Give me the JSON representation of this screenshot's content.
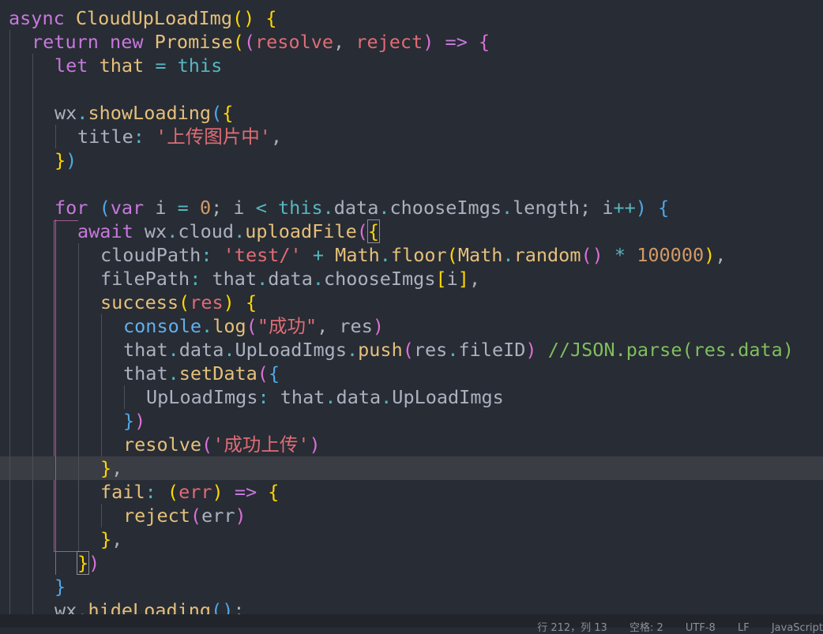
{
  "editor": {
    "lines": [
      [
        [
          "t-kw",
          "async "
        ],
        [
          "t-fn2",
          "CloudUpLoadImg"
        ],
        [
          "t-b1",
          "()"
        ],
        [
          "t-var",
          " "
        ],
        [
          "t-b1",
          "{"
        ]
      ],
      [
        [
          "t-kw",
          "return "
        ],
        [
          "t-kw",
          "new "
        ],
        [
          "t-cls",
          "Promise"
        ],
        [
          "t-b1",
          "("
        ],
        [
          "t-b2",
          "("
        ],
        [
          "t-param",
          "resolve"
        ],
        [
          "t-var",
          ", "
        ],
        [
          "t-param",
          "reject"
        ],
        [
          "t-b2",
          ")"
        ],
        [
          "t-var",
          " "
        ],
        [
          "t-kw",
          "=>"
        ],
        [
          "t-var",
          " "
        ],
        [
          "t-b2",
          "{"
        ]
      ],
      [
        [
          "t-kw",
          "let "
        ],
        [
          "t-cls",
          "that"
        ],
        [
          "t-var",
          " "
        ],
        [
          "t-op",
          "="
        ],
        [
          "t-var",
          " "
        ],
        [
          "t-this",
          "this"
        ]
      ],
      [],
      [
        [
          "t-var",
          "wx"
        ],
        [
          "t-op",
          "."
        ],
        [
          "t-fn2",
          "showLoading"
        ],
        [
          "t-b3",
          "("
        ],
        [
          "t-b1",
          "{"
        ]
      ],
      [
        [
          "t-var",
          "title"
        ],
        [
          "t-op",
          ":"
        ],
        [
          "t-var",
          " "
        ],
        [
          "t-strzh",
          "'上传图片中'"
        ],
        [
          "t-var",
          ","
        ]
      ],
      [
        [
          "t-b1",
          "}"
        ],
        [
          "t-b3",
          ")"
        ]
      ],
      [],
      [
        [
          "t-kw",
          "for "
        ],
        [
          "t-b3",
          "("
        ],
        [
          "t-kw",
          "var "
        ],
        [
          "t-var",
          "i "
        ],
        [
          "t-op",
          "="
        ],
        [
          "t-var",
          " "
        ],
        [
          "t-num",
          "0"
        ],
        [
          "t-var",
          "; i "
        ],
        [
          "t-op",
          "<"
        ],
        [
          "t-var",
          " "
        ],
        [
          "t-this",
          "this"
        ],
        [
          "t-op",
          "."
        ],
        [
          "t-var",
          "data"
        ],
        [
          "t-op",
          "."
        ],
        [
          "t-var",
          "chooseImgs"
        ],
        [
          "t-op",
          "."
        ],
        [
          "t-var",
          "length; i"
        ],
        [
          "t-op",
          "++"
        ],
        [
          "t-b3",
          ")"
        ],
        [
          "t-var",
          " "
        ],
        [
          "t-b3",
          "{"
        ]
      ],
      [
        [
          "t-kw",
          "await "
        ],
        [
          "t-var",
          "wx"
        ],
        [
          "t-op",
          "."
        ],
        [
          "t-var",
          "cloud"
        ],
        [
          "t-op",
          "."
        ],
        [
          "t-fn2",
          "uploadFile"
        ],
        [
          "t-b2",
          "("
        ],
        [
          "box",
          "{"
        ]
      ],
      [
        [
          "t-var",
          "cloudPath"
        ],
        [
          "t-op",
          ":"
        ],
        [
          "t-var",
          " "
        ],
        [
          "t-strzh",
          "'test/'"
        ],
        [
          "t-var",
          " "
        ],
        [
          "t-op",
          "+"
        ],
        [
          "t-var",
          " "
        ],
        [
          "t-cls",
          "Math"
        ],
        [
          "t-op",
          "."
        ],
        [
          "t-fn2",
          "floor"
        ],
        [
          "t-b1",
          "("
        ],
        [
          "t-cls",
          "Math"
        ],
        [
          "t-op",
          "."
        ],
        [
          "t-fn2",
          "random"
        ],
        [
          "t-b2",
          "()"
        ],
        [
          "t-var",
          " "
        ],
        [
          "t-op",
          "*"
        ],
        [
          "t-var",
          " "
        ],
        [
          "t-num",
          "100000"
        ],
        [
          "t-b1",
          ")"
        ],
        [
          "t-var",
          ","
        ]
      ],
      [
        [
          "t-var",
          "filePath"
        ],
        [
          "t-op",
          ":"
        ],
        [
          "t-var",
          " that"
        ],
        [
          "t-op",
          "."
        ],
        [
          "t-var",
          "data"
        ],
        [
          "t-op",
          "."
        ],
        [
          "t-var",
          "chooseImgs"
        ],
        [
          "t-b1",
          "["
        ],
        [
          "t-var",
          "i"
        ],
        [
          "t-b1",
          "]"
        ],
        [
          "t-var",
          ","
        ]
      ],
      [
        [
          "t-fn2",
          "success"
        ],
        [
          "t-b1",
          "("
        ],
        [
          "t-param",
          "res"
        ],
        [
          "t-b1",
          ")"
        ],
        [
          "t-var",
          " "
        ],
        [
          "t-b1",
          "{"
        ]
      ],
      [
        [
          "t-fn",
          "console"
        ],
        [
          "t-op",
          "."
        ],
        [
          "t-fn2",
          "log"
        ],
        [
          "t-b2",
          "("
        ],
        [
          "t-strzh",
          "\"成功\""
        ],
        [
          "t-var",
          ", res"
        ],
        [
          "t-b2",
          ")"
        ]
      ],
      [
        [
          "t-var",
          "that"
        ],
        [
          "t-op",
          "."
        ],
        [
          "t-var",
          "data"
        ],
        [
          "t-op",
          "."
        ],
        [
          "t-var",
          "UpLoadImgs"
        ],
        [
          "t-op",
          "."
        ],
        [
          "t-fn2",
          "push"
        ],
        [
          "t-b2",
          "("
        ],
        [
          "t-var",
          "res"
        ],
        [
          "t-op",
          "."
        ],
        [
          "t-var",
          "fileID"
        ],
        [
          "t-b2",
          ")"
        ],
        [
          "t-var",
          " "
        ],
        [
          "t-com",
          "//JSON.parse(res.data)"
        ]
      ],
      [
        [
          "t-var",
          "that"
        ],
        [
          "t-op",
          "."
        ],
        [
          "t-fn2",
          "setData"
        ],
        [
          "t-b2",
          "("
        ],
        [
          "t-b3",
          "{"
        ]
      ],
      [
        [
          "t-var",
          "UpLoadImgs"
        ],
        [
          "t-op",
          ":"
        ],
        [
          "t-var",
          " that"
        ],
        [
          "t-op",
          "."
        ],
        [
          "t-var",
          "data"
        ],
        [
          "t-op",
          "."
        ],
        [
          "t-var",
          "UpLoadImgs"
        ]
      ],
      [
        [
          "t-b3",
          "}"
        ],
        [
          "t-b2",
          ")"
        ]
      ],
      [
        [
          "t-fn2",
          "resolve"
        ],
        [
          "t-b2",
          "("
        ],
        [
          "t-strzh",
          "'成功上传'"
        ],
        [
          "t-b2",
          ")"
        ]
      ],
      [
        [
          "t-b1",
          "}"
        ],
        [
          "t-var",
          ","
        ]
      ],
      [
        [
          "t-fn2",
          "fail"
        ],
        [
          "t-op",
          ":"
        ],
        [
          "t-var",
          " "
        ],
        [
          "t-b1",
          "("
        ],
        [
          "t-param",
          "err"
        ],
        [
          "t-b1",
          ")"
        ],
        [
          "t-var",
          " "
        ],
        [
          "t-kw",
          "=>"
        ],
        [
          "t-var",
          " "
        ],
        [
          "t-b1",
          "{"
        ]
      ],
      [
        [
          "t-fn2",
          "reject"
        ],
        [
          "t-b2",
          "("
        ],
        [
          "t-var",
          "err"
        ],
        [
          "t-b2",
          ")"
        ]
      ],
      [
        [
          "t-b1",
          "}"
        ],
        [
          "t-var",
          ","
        ]
      ],
      [
        [
          "box",
          "}"
        ],
        [
          "t-b2",
          ")"
        ]
      ],
      [
        [
          "t-b3",
          "}"
        ]
      ],
      [
        [
          "t-var",
          "wx"
        ],
        [
          "t-op",
          "."
        ],
        [
          "t-fn2",
          "hideLoading"
        ],
        [
          "t-b3",
          "()"
        ],
        [
          "t-var",
          ";"
        ]
      ]
    ]
  },
  "statusbar": {
    "line_col": "行 212，列 13",
    "indent": "空格: 2",
    "encoding": "UTF-8",
    "eol": "LF",
    "language": "JavaScript"
  }
}
